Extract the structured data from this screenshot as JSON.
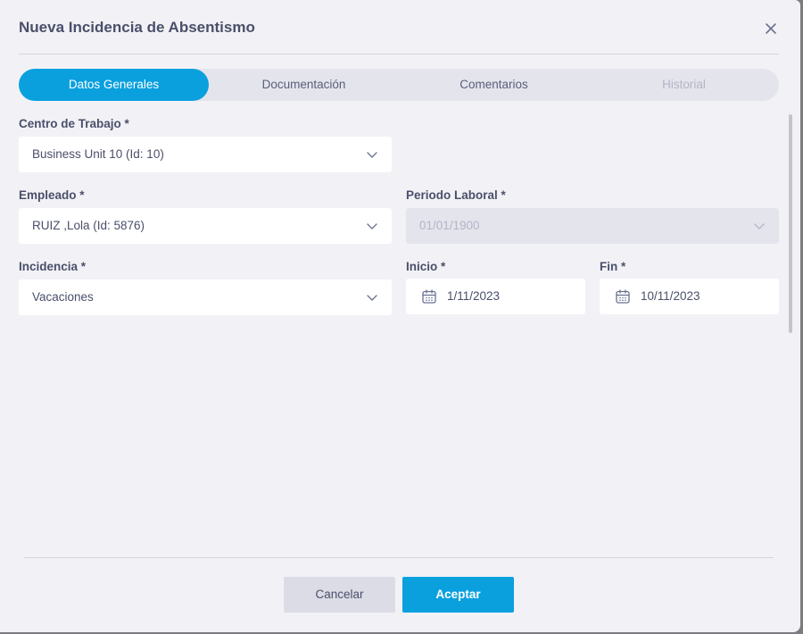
{
  "modal": {
    "title": "Nueva Incidencia de Absentismo"
  },
  "tabs": [
    {
      "label": "Datos Generales",
      "state": "active"
    },
    {
      "label": "Documentación",
      "state": "normal"
    },
    {
      "label": "Comentarios",
      "state": "normal"
    },
    {
      "label": "Historial",
      "state": "disabled"
    }
  ],
  "form": {
    "centro_trabajo": {
      "label": "Centro de Trabajo *",
      "value": "Business Unit 10 (Id: 10)"
    },
    "empleado": {
      "label": "Empleado *",
      "value": "RUIZ ,Lola (Id: 5876)"
    },
    "periodo_laboral": {
      "label": "Periodo Laboral *",
      "value": "01/01/1900",
      "disabled": true
    },
    "incidencia": {
      "label": "Incidencia *",
      "value": "Vacaciones"
    },
    "inicio": {
      "label": "Inicio *",
      "value": "1/11/2023"
    },
    "fin": {
      "label": "Fin *",
      "value": "10/11/2023"
    }
  },
  "footer": {
    "cancel_label": "Cancelar",
    "accept_label": "Aceptar"
  },
  "icons": {
    "close": "close-icon",
    "chevron": "chevron-down-icon",
    "calendar": "calendar-icon"
  },
  "colors": {
    "accent": "#0aa0de",
    "text": "#4a4f6a",
    "disabled_text": "#b3b5c6",
    "modal_bg": "#f2f2f6"
  }
}
